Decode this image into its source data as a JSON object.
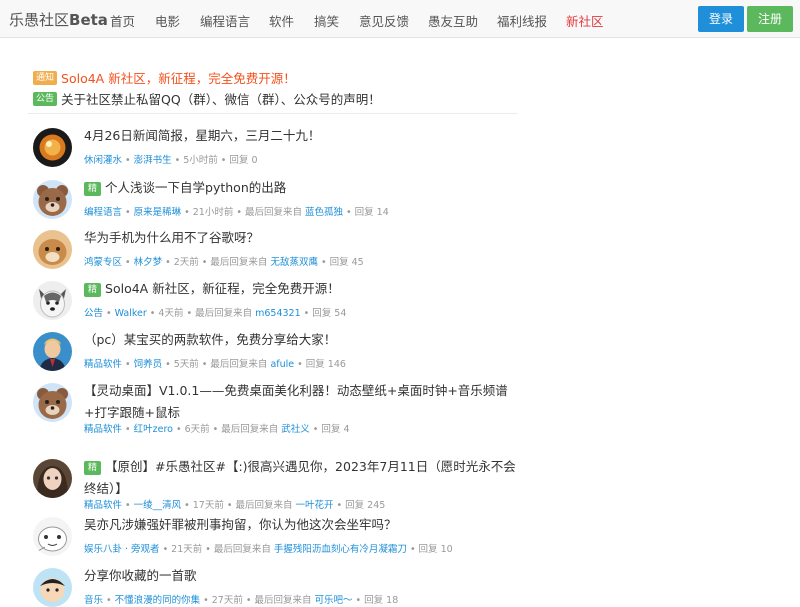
{
  "nav": {
    "brand_prefix": "乐愚社区",
    "brand_suffix": "Beta",
    "items": [
      "首页",
      "电影",
      "编程语言",
      "软件",
      "搞笑",
      "意见反馈",
      "愚友互助",
      "福利线报",
      "新社区"
    ],
    "login": "登录",
    "register": "注册"
  },
  "notices": [
    {
      "badge": "通知",
      "text": "Solo4A 新社区，新征程，完全免费开源！"
    },
    {
      "badge": "公告",
      "text": "关于社区禁止私留QQ（群）、微信（群）、公众号的声明！"
    }
  ],
  "labels": {
    "essence_badge": "精",
    "last_reply_from": "最后回复来自",
    "reply": "回复",
    "sep": "•"
  },
  "topics": [
    {
      "title": "4月26日新闻简报，星期六，三月二十九！",
      "essence": false,
      "category": "休闲灌水",
      "author": "澎湃书生",
      "time": "5小时前",
      "last_reply_user": "",
      "replies": "0"
    },
    {
      "title": "个人浅谈一下自学python的出路",
      "essence": true,
      "category": "编程语言",
      "author": "原来是稀琳",
      "time": "21小时前",
      "last_reply_user": "蓝色孤独",
      "replies": "14"
    },
    {
      "title": "华为手机为什么用不了谷歌呀？",
      "essence": false,
      "category": "鸿蒙专区",
      "author": "林夕梦",
      "time": "2天前",
      "last_reply_user": "无敌蒸双鹰",
      "replies": "45"
    },
    {
      "title": "Solo4A 新社区，新征程，完全免费开源！",
      "essence": true,
      "category": "公告",
      "author": "Walker",
      "time": "4天前",
      "last_reply_user": "m654321",
      "replies": "54"
    },
    {
      "title": "（pc）某宝买的两款软件，免费分享给大家！",
      "essence": false,
      "category": "精品软件",
      "author": "饲养员",
      "time": "5天前",
      "last_reply_user": "afule",
      "replies": "146"
    },
    {
      "title": "【灵动桌面】V1.0.1——免费桌面美化利器！动态壁纸+桌面时钟+音乐频谱+打字跟随+鼠标",
      "essence": false,
      "category": "精品软件",
      "author": "红叶zero",
      "time": "6天前",
      "last_reply_user": "武社义",
      "replies": "4"
    },
    {
      "title": "【原创】#乐愚社区#【:)很高兴遇见你，2023年7月11日（愿时光永不会终结）】",
      "essence": true,
      "category": "精品软件",
      "author": "一绫__清风",
      "time": "17天前",
      "last_reply_user": "一叶花开",
      "replies": "245"
    },
    {
      "title": "吴亦凡涉嫌强奸罪被刑事拘留，你认为他这次会坐牢吗？",
      "essence": false,
      "category": "娱乐八卦 · 旁观者",
      "author": "",
      "time": "21天前",
      "last_reply_user": "手握残阳沥血刻心有冷月凝霜刀",
      "replies": "10"
    },
    {
      "title": "分享你收藏的一首歌",
      "essence": false,
      "category": "音乐",
      "author": "不懂浪漫的同的你集",
      "time": "27天前",
      "last_reply_user": "可乐吧～",
      "replies": "18"
    }
  ],
  "colors": {
    "link": "#1e8fd8",
    "accent": "#e4393c",
    "essence": "#5cb85c",
    "notice": "#f0ad4e",
    "notice_text": "#f4511e"
  }
}
